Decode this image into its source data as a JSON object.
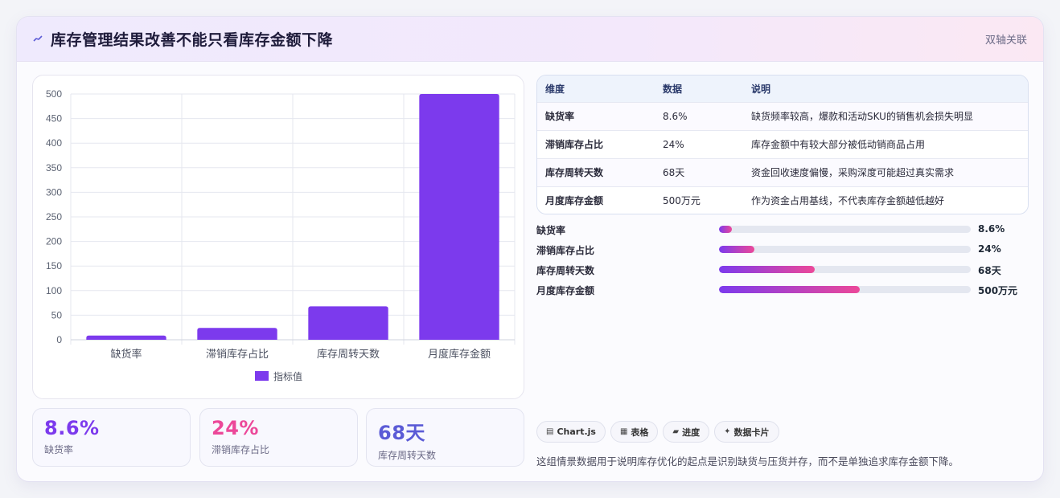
{
  "header": {
    "icon": "trend-icon",
    "title": "库存管理结果改善不能只看库存金额下降",
    "tag": "双轴关联"
  },
  "chart_data": {
    "type": "bar",
    "categories": [
      "缺货率",
      "滞销库存占比",
      "库存周转天数",
      "月度库存金额"
    ],
    "series": [
      {
        "name": "指标值",
        "values": [
          8.6,
          24,
          68,
          500
        ],
        "color": "#7c3aed"
      }
    ],
    "y_ticks": [
      "0",
      "50",
      "100",
      "150",
      "200",
      "250",
      "300",
      "350",
      "400",
      "450",
      "500"
    ],
    "ylim": [
      0,
      500
    ],
    "grid": true,
    "legend_position": "bottom"
  },
  "stats": [
    {
      "value": "8.6%",
      "label": "缺货率",
      "color": "#7c3aed"
    },
    {
      "value": "24%",
      "label": "滞销库存占比",
      "color": "#ec4899"
    },
    {
      "value": "68天",
      "label": "库存周转天数",
      "color": "#5b5bd6"
    }
  ],
  "table": {
    "headers": [
      "维度",
      "数据",
      "说明"
    ],
    "rows": [
      [
        "缺货率",
        "8.6%",
        "缺货频率较高，爆款和活动SKU的销售机会损失明显"
      ],
      [
        "滞销库存占比",
        "24%",
        "库存金额中有较大部分被低动销商品占用"
      ],
      [
        "库存周转天数",
        "68天",
        "资金回收速度偏慢，采购深度可能超过真实需求"
      ],
      [
        "月度库存金额",
        "500万元",
        "作为资金占用基线，不代表库存金额越低越好"
      ]
    ]
  },
  "progress": [
    {
      "label": "缺货率",
      "value": "8.6%",
      "fraction": 0.05
    },
    {
      "label": "滞销库存占比",
      "value": "24%",
      "fraction": 0.14
    },
    {
      "label": "库存周转天数",
      "value": "68天",
      "fraction": 0.38
    },
    {
      "label": "月度库存金额",
      "value": "500万元",
      "fraction": 0.56
    }
  ],
  "tags": [
    {
      "icon": "chart-icon",
      "glyph": "▤",
      "label": "Chart.js"
    },
    {
      "icon": "table-icon",
      "glyph": "▦",
      "label": "表格"
    },
    {
      "icon": "progress-icon",
      "glyph": "▰",
      "label": "进度"
    },
    {
      "icon": "sparkle-icon",
      "glyph": "✦",
      "label": "数据卡片"
    }
  ],
  "note": "这组情景数据用于说明库存优化的起点是识别缺货与压货并存，而不是单独追求库存金额下降。"
}
